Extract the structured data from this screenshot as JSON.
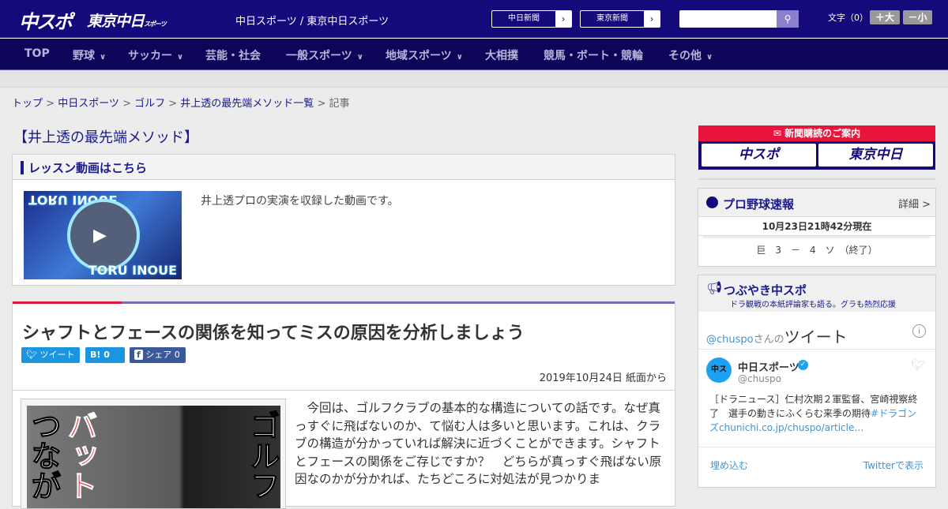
{
  "header": {
    "logo_chuspo": "中スポ",
    "logo_tokyo": "東京中日",
    "logo_tokyo_sub": "スポーツ",
    "tagline": "中日スポーツ / 東京中日スポーツ",
    "paper_links": [
      {
        "label": "中日新聞"
      },
      {
        "label": "東京新聞"
      }
    ],
    "search_placeholder": "",
    "font_size_label": "文字（0）",
    "font_larger": "＋大",
    "font_smaller": "－小"
  },
  "nav": [
    {
      "label": "TOP"
    },
    {
      "label": "野球",
      "dropdown": true
    },
    {
      "label": "サッカー",
      "dropdown": true
    },
    {
      "label": "芸能・社会"
    },
    {
      "label": "一般スポーツ",
      "dropdown": true
    },
    {
      "label": "地域スポーツ",
      "dropdown": true
    },
    {
      "label": "大相撲"
    },
    {
      "label": "競馬・ボート・競輪"
    },
    {
      "label": "その他",
      "dropdown": true
    }
  ],
  "breadcrumb": [
    "トップ",
    "中日スポーツ",
    "ゴルフ",
    "井上透の最先端メソッド一覧",
    "記事"
  ],
  "page_title": "【井上透の最先端メソッド】",
  "video": {
    "heading": "レッスン動画はこちら",
    "description": "井上透プロの実演を収録した動画です。",
    "thumb_text": "TORU INOUE"
  },
  "article": {
    "title": "シャフトとフェースの関係を知ってミスの原因を分析しましょう",
    "share": {
      "tweet": "ツイート",
      "hatena": "B!",
      "hatena_count": "0",
      "facebook": "シェア",
      "facebook_count": "0"
    },
    "date": "2019年10月24日 紙面から",
    "image_text": {
      "left": "つなが",
      "red": "バット",
      "right": "ゴルフ"
    },
    "body": "　今回は、ゴルフクラブの基本的な構造についての話です。なぜ真っすぐに飛ばないのか、て悩む人は多いと思います。これは、クラブの構造が分かっていれば解決に近づくことができます。シャフトとフェースの関係をご存じですか？　どちらが真っすぐ飛ばない原因なのかが分かれば、たちどころに対処法が見つかりま"
  },
  "sidebar": {
    "subscribe": {
      "title": "新聞購読のご案内",
      "chuspo": "中スポ",
      "tokyo": "東京中日"
    },
    "baseball": {
      "title": "プロ野球速報",
      "detail": "詳細 >",
      "time": "10月23日21時42分現在",
      "score": "巨　3　－　4　ソ　（終了）"
    },
    "tweets": {
      "title": "つぶやき中スポ",
      "subtitle": "ドラ観戦の本紙評論家も語る。グラも熱烈応援",
      "handle_link": "@chuspo",
      "handle_suffix": "さんの",
      "heading": "ツイート",
      "account_name": "中日スポーツ",
      "account_handle": "@chuspo",
      "text": "［ドラニュース］仁村次期２軍監督、宮崎視察終了　選手の動きにふくらむ来季の期待",
      "hashtag": "#ドラゴンズ",
      "link": "chunichi.co.jp/chuspo/article…",
      "embed": "埋め込む",
      "view_on_twitter": "Twitterで表示"
    }
  }
}
